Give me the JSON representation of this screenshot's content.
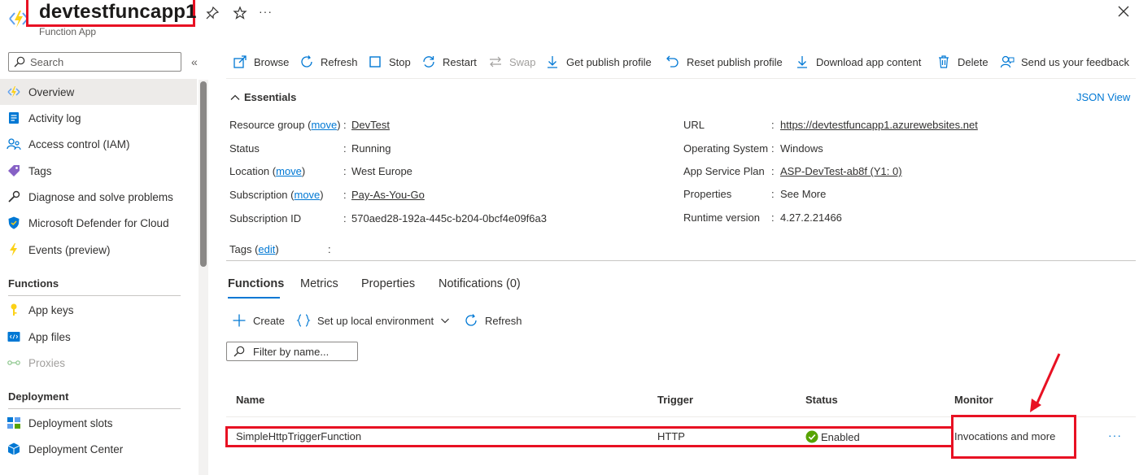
{
  "header": {
    "title": "devtestfuncapp1",
    "subtitle": "Function App",
    "more": "···"
  },
  "sidebar": {
    "search_placeholder": "Search",
    "collapse": "«",
    "items": [
      {
        "label": "Overview",
        "icon": "function-app-icon"
      },
      {
        "label": "Activity log",
        "icon": "activity-log-icon"
      },
      {
        "label": "Access control (IAM)",
        "icon": "iam-icon"
      },
      {
        "label": "Tags",
        "icon": "tag-icon"
      },
      {
        "label": "Diagnose and solve problems",
        "icon": "wrench-icon"
      },
      {
        "label": "Microsoft Defender for Cloud",
        "icon": "shield-icon"
      },
      {
        "label": "Events (preview)",
        "icon": "lightning-icon"
      }
    ],
    "section_functions": "Functions",
    "functions_items": [
      {
        "label": "App keys",
        "icon": "key-icon"
      },
      {
        "label": "App files",
        "icon": "code-file-icon"
      },
      {
        "label": "Proxies",
        "icon": "proxy-icon"
      }
    ],
    "section_deployment": "Deployment",
    "deployment_items": [
      {
        "label": "Deployment slots",
        "icon": "slots-icon"
      },
      {
        "label": "Deployment Center",
        "icon": "cube-icon"
      }
    ]
  },
  "toolbar": {
    "browse": "Browse",
    "refresh": "Refresh",
    "stop": "Stop",
    "restart": "Restart",
    "swap": "Swap",
    "get_publish_profile": "Get publish profile",
    "reset_publish_profile": "Reset publish profile",
    "download_app_content": "Download app content",
    "delete": "Delete",
    "feedback": "Send us your feedback"
  },
  "essentials": {
    "toggle": "Essentials",
    "json_view": "JSON View",
    "move": "move",
    "left": {
      "resource_group_label": "Resource group",
      "resource_group_value": "DevTest",
      "status_label": "Status",
      "status_value": "Running",
      "location_label": "Location",
      "location_value": "West Europe",
      "subscription_label": "Subscription",
      "subscription_value": "Pay-As-You-Go",
      "subscription_id_label": "Subscription ID",
      "subscription_id_value": "570aed28-192a-445c-b204-0bcf4e09f6a3"
    },
    "right": {
      "url_label": "URL",
      "url_value": "https://devtestfuncapp1.azurewebsites.net",
      "os_label": "Operating System",
      "os_value": "Windows",
      "plan_label": "App Service Plan",
      "plan_value": "ASP-DevTest-ab8f (Y1: 0)",
      "properties_label": "Properties",
      "properties_value": "See More",
      "runtime_label": "Runtime version",
      "runtime_value": "4.27.2.21466"
    },
    "tags_label": "Tags",
    "tags_edit": "edit",
    "colon": ":"
  },
  "tabs": [
    "Functions",
    "Metrics",
    "Properties",
    "Notifications (0)"
  ],
  "functions_toolbar": {
    "create": "Create",
    "local_env": "Set up local environment",
    "refresh": "Refresh",
    "filter_placeholder": "Filter by name..."
  },
  "table": {
    "columns": [
      "Name",
      "Trigger",
      "Status",
      "Monitor"
    ],
    "rows": [
      {
        "name": "SimpleHttpTriggerFunction",
        "trigger": "HTTP",
        "status": "Enabled",
        "monitor": "Invocations and more",
        "more": "···"
      }
    ]
  },
  "colors": {
    "accent": "#0078d4",
    "annotation": "#e81123",
    "success": "#57a300"
  }
}
